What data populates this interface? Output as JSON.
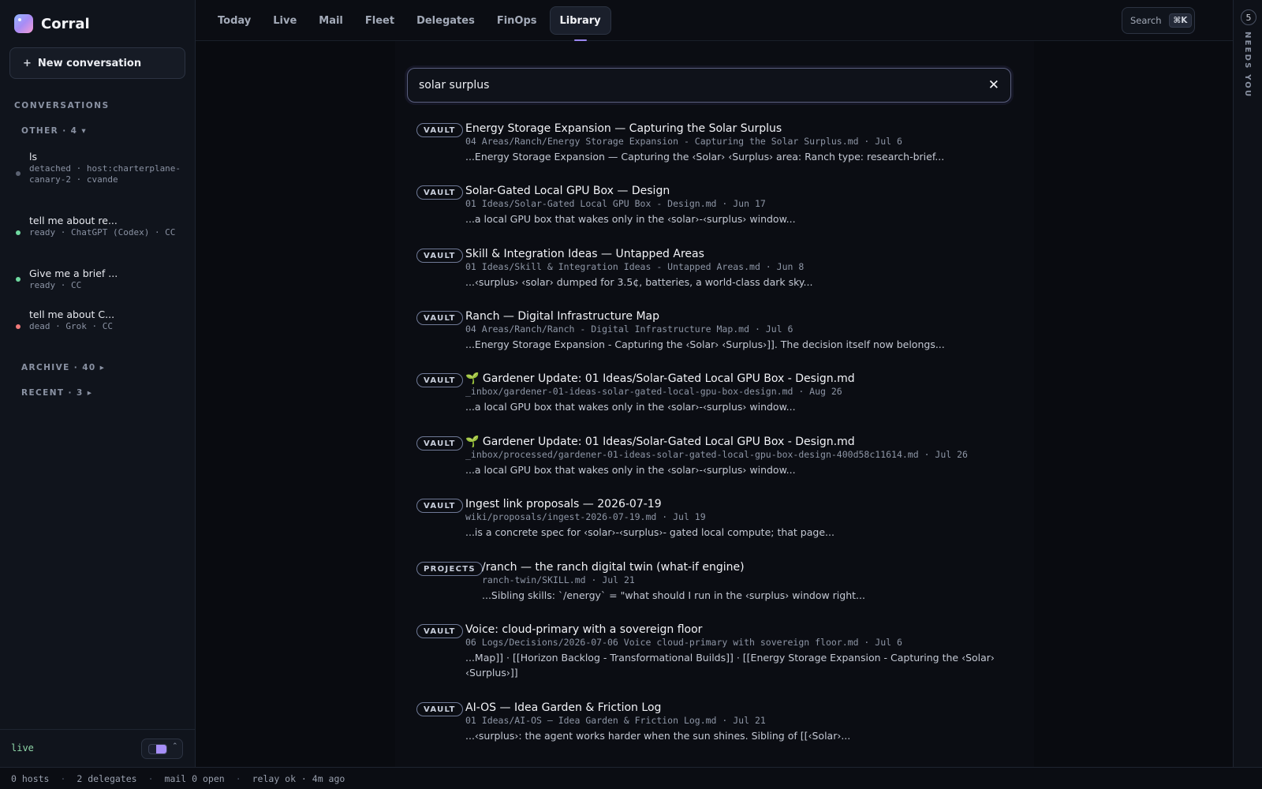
{
  "brand": {
    "name": "Corral"
  },
  "sidebar": {
    "new_conversation": "New conversation",
    "section": "CONVERSATIONS",
    "groups": {
      "other": "OTHER · 4 ▾",
      "archive": "ARCHIVE · 40 ▸",
      "recent": "RECENT · 3 ▸"
    },
    "conversations": [
      {
        "title": "ls",
        "meta": "detached · host:charterplane-canary-2 · cvande",
        "status_color": "#5b6272"
      },
      {
        "title": "tell me about re...",
        "meta": "ready · ChatGPT (Codex) · CC",
        "status_color": "#6fd9a0"
      },
      {
        "title": "Give me a brief ...",
        "meta": "ready · CC",
        "status_color": "#6fd9a0"
      },
      {
        "title": "tell me about C...",
        "meta": "dead · Grok · CC",
        "status_color": "#f07a7a"
      }
    ],
    "footer": {
      "live": "live"
    }
  },
  "nav": {
    "tabs": [
      "Today",
      "Live",
      "Mail",
      "Fleet",
      "Delegates",
      "FinOps",
      "Library"
    ],
    "active": "Library",
    "search_label": "Search",
    "search_shortcut": "⌘K"
  },
  "rail": {
    "count": "5",
    "label": "NEEDS YOU"
  },
  "search": {
    "query": "solar surplus"
  },
  "results": [
    {
      "tag": "VAULT",
      "title": "Energy Storage Expansion — Capturing the Solar Surplus",
      "path": "04 Areas/Ranch/Energy Storage Expansion - Capturing the Solar Surplus.md · Jul 6",
      "snippet": "...Energy Storage Expansion — Capturing the ‹Solar› ‹Surplus› area: Ranch type: research-brief..."
    },
    {
      "tag": "VAULT",
      "title": "Solar-Gated Local GPU Box — Design",
      "path": "01 Ideas/Solar-Gated Local GPU Box - Design.md · Jun 17",
      "snippet": "...a local GPU box that wakes only in the ‹solar›-‹surplus› window..."
    },
    {
      "tag": "VAULT",
      "title": "Skill & Integration Ideas — Untapped Areas",
      "path": "01 Ideas/Skill & Integration Ideas - Untapped Areas.md · Jun 8",
      "snippet": "...‹surplus› ‹solar› dumped for 3.5¢, batteries, a world-class dark sky..."
    },
    {
      "tag": "VAULT",
      "title": "Ranch — Digital Infrastructure Map",
      "path": "04 Areas/Ranch/Ranch - Digital Infrastructure Map.md · Jul 6",
      "snippet": "...Energy Storage Expansion - Capturing the ‹Solar› ‹Surplus›]]. The decision itself now belongs..."
    },
    {
      "tag": "VAULT",
      "title": "🌱 Gardener Update: 01 Ideas/Solar-Gated Local GPU Box - Design.md",
      "path": "_inbox/gardener-01-ideas-solar-gated-local-gpu-box-design.md · Aug 26",
      "snippet": "...a local GPU box that wakes only in the ‹solar›-‹surplus› window..."
    },
    {
      "tag": "VAULT",
      "title": "🌱 Gardener Update: 01 Ideas/Solar-Gated Local GPU Box - Design.md",
      "path": "_inbox/processed/gardener-01-ideas-solar-gated-local-gpu-box-design-400d58c11614.md · Jul 26",
      "snippet": "...a local GPU box that wakes only in the ‹solar›-‹surplus› window..."
    },
    {
      "tag": "VAULT",
      "title": "Ingest link proposals — 2026-07-19",
      "path": "wiki/proposals/ingest-2026-07-19.md · Jul 19",
      "snippet": "...is a concrete spec for ‹solar›-‹surplus›- gated local compute; that page..."
    },
    {
      "tag": "PROJECTS",
      "title": "/ranch — the ranch digital twin (what-if engine)",
      "path": "ranch-twin/SKILL.md · Jul 21",
      "snippet": "...Sibling skills: `/energy` = \"what should I run in the ‹surplus› window right..."
    },
    {
      "tag": "VAULT",
      "title": "Voice: cloud-primary with a sovereign floor",
      "path": "06 Logs/Decisions/2026-07-06 Voice cloud-primary with sovereign floor.md · Jul 6",
      "snippet": "...Map]] · [[Horizon Backlog - Transformational Builds]] · [[Energy Storage Expansion - Capturing the ‹Solar› ‹Surplus›]]"
    },
    {
      "tag": "VAULT",
      "title": "AI-OS — Idea Garden & Friction Log",
      "path": "01 Ideas/AI-OS — Idea Garden & Friction Log.md · Jul 21",
      "snippet": "...‹surplus›: the agent works harder when the sun shines. Sibling of [[‹Solar›..."
    }
  ],
  "status": {
    "hosts": "0 hosts",
    "delegates": "2 delegates",
    "mail": "mail 0 open",
    "relay": "relay ok · 4m ago"
  }
}
